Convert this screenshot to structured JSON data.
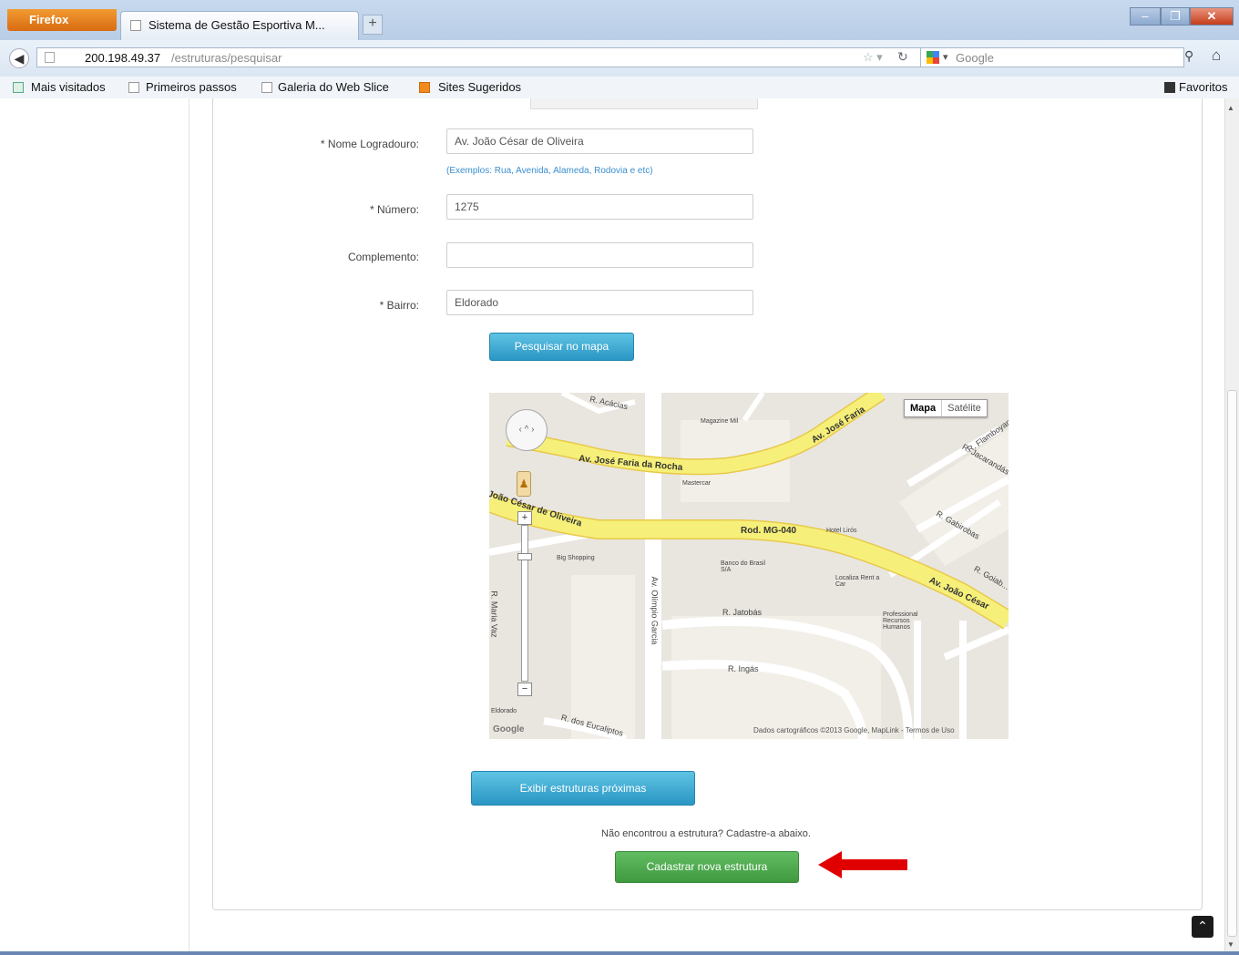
{
  "browser": {
    "menu_button": "Firefox",
    "tab_title": "Sistema de Gestão Esportiva M...",
    "new_tab": "+",
    "url_host": "200.198.49.37",
    "url_path": "/estruturas/pesquisar",
    "search_placeholder": "Google",
    "bookmarks": [
      "Mais visitados",
      "Primeiros passos",
      "Galeria do Web Slice",
      "Sites Sugeridos"
    ],
    "favorites": "Favoritos"
  },
  "form": {
    "logradouro_label": "* Nome Logradouro:",
    "logradouro_value": "Av. João César de Oliveira",
    "logradouro_hint": "(Exemplos: Rua, Avenida, Alameda, Rodovia e etc)",
    "numero_label": "* Número:",
    "numero_value": "1275",
    "complemento_label": "Complemento:",
    "complemento_value": "",
    "bairro_label": "* Bairro:",
    "bairro_value": "Eldorado",
    "search_button": "Pesquisar no mapa"
  },
  "map": {
    "type_map": "Mapa",
    "type_satellite": "Satélite",
    "attribution": "Dados cartográficos ©2013 Google, MapLink - Termos de Uso",
    "google": "Google",
    "roads": {
      "jose_faria": "Av. José Faria da Rocha",
      "jose_faria_top": "Av. José Faria",
      "joao_cesar_left": "João César de Oliveira",
      "rod_mg": "Rod. MG-040",
      "joao_cesar_right": "Av. João César",
      "olimpio": "Av. Olímpio Garcia",
      "acacias": "R. Acácias",
      "jatobas": "R. Jatobás",
      "ingas": "R. Ingás",
      "maria_vaz": "R. Maria Vaz",
      "eucaliptos": "R. dos Eucaliptos",
      "jacarandas": "R. Jacarandás",
      "gabirobas": "R. Gabirobas",
      "goiabeiras": "R. Goiab...",
      "flamboyants": "R. Flamboyants"
    },
    "places": {
      "shopping": "Big Shopping",
      "banco": "Banco do Brasil S/A",
      "hotel": "Hotel Lirós",
      "localiza": "Localiza Rent a Car",
      "magazine": "Magazine Mil",
      "mastercar": "Mastercar",
      "professional": "Professional Recursos Humanos",
      "eldorado": "Eldorado"
    }
  },
  "actions": {
    "show_nearby": "Exibir estruturas próximas",
    "not_found": "Não encontrou a estrutura? Cadastre-a abaixo.",
    "new_structure": "Cadastrar nova estrutura"
  },
  "colors": {
    "primary_button": "#2a96c4",
    "success_button": "#3f9a3f",
    "annotation_arrow": "#e00000",
    "road_yellow": "#f6f07a"
  }
}
